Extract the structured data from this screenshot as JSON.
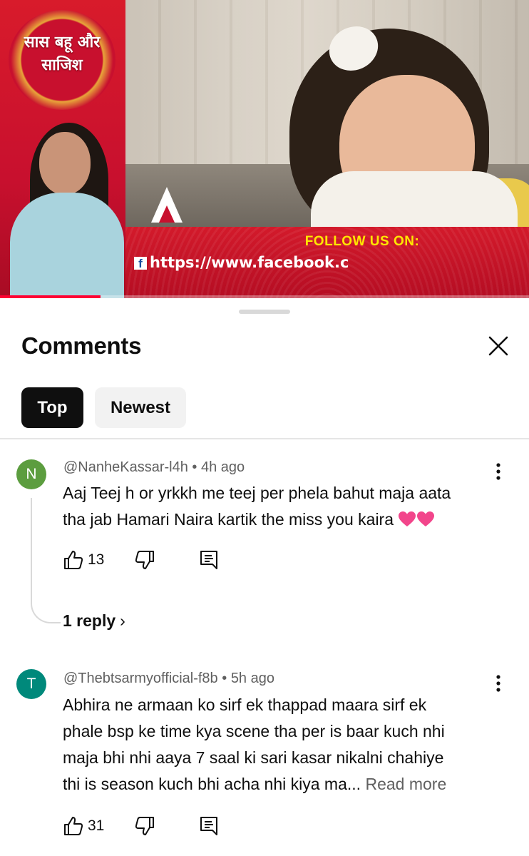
{
  "video": {
    "logo_text_line1": "सास बहू और",
    "logo_text_line2": "साजिश",
    "follow_title": "FOLLOW US ON:",
    "follow_icon": "facebook-icon",
    "follow_url": "https://www.facebook.c",
    "progress": 0.19,
    "progress_color": "#ff0033"
  },
  "sheet": {
    "title": "Comments",
    "close_icon": "close-icon"
  },
  "filters": {
    "top": "Top",
    "newest": "Newest",
    "selected": "Top"
  },
  "comments": [
    {
      "avatar_letter": "N",
      "avatar_color": "#5c9d3f",
      "author": "@NanheKassar-l4h",
      "separator": " • ",
      "time": "4h ago",
      "text_line1": "Aaj Teej h or yrkkh me teej per phela bahut maja aata",
      "text_line2": "tha jab Hamari Naira kartik the miss you kaira",
      "emoji": "heart-emoji",
      "likes": "13",
      "replies": "1 reply"
    },
    {
      "avatar_letter": "T",
      "avatar_color": "#00897b",
      "author": "@Thebtsarmyofficial-f8b",
      "separator": " • ",
      "time": "5h ago",
      "text_line1": "Abhira ne armaan ko sirf ek thappad maara sirf ek",
      "text_line2": "phale bsp ke time kya scene tha per is baar kuch nhi",
      "text_line3": "maja bhi nhi aaya 7 saal ki sari kasar nikalni chahiye",
      "text_line4": "thi is season kuch bhi acha nhi kiya ma...",
      "read_more": "Read more",
      "likes": "31"
    }
  ]
}
